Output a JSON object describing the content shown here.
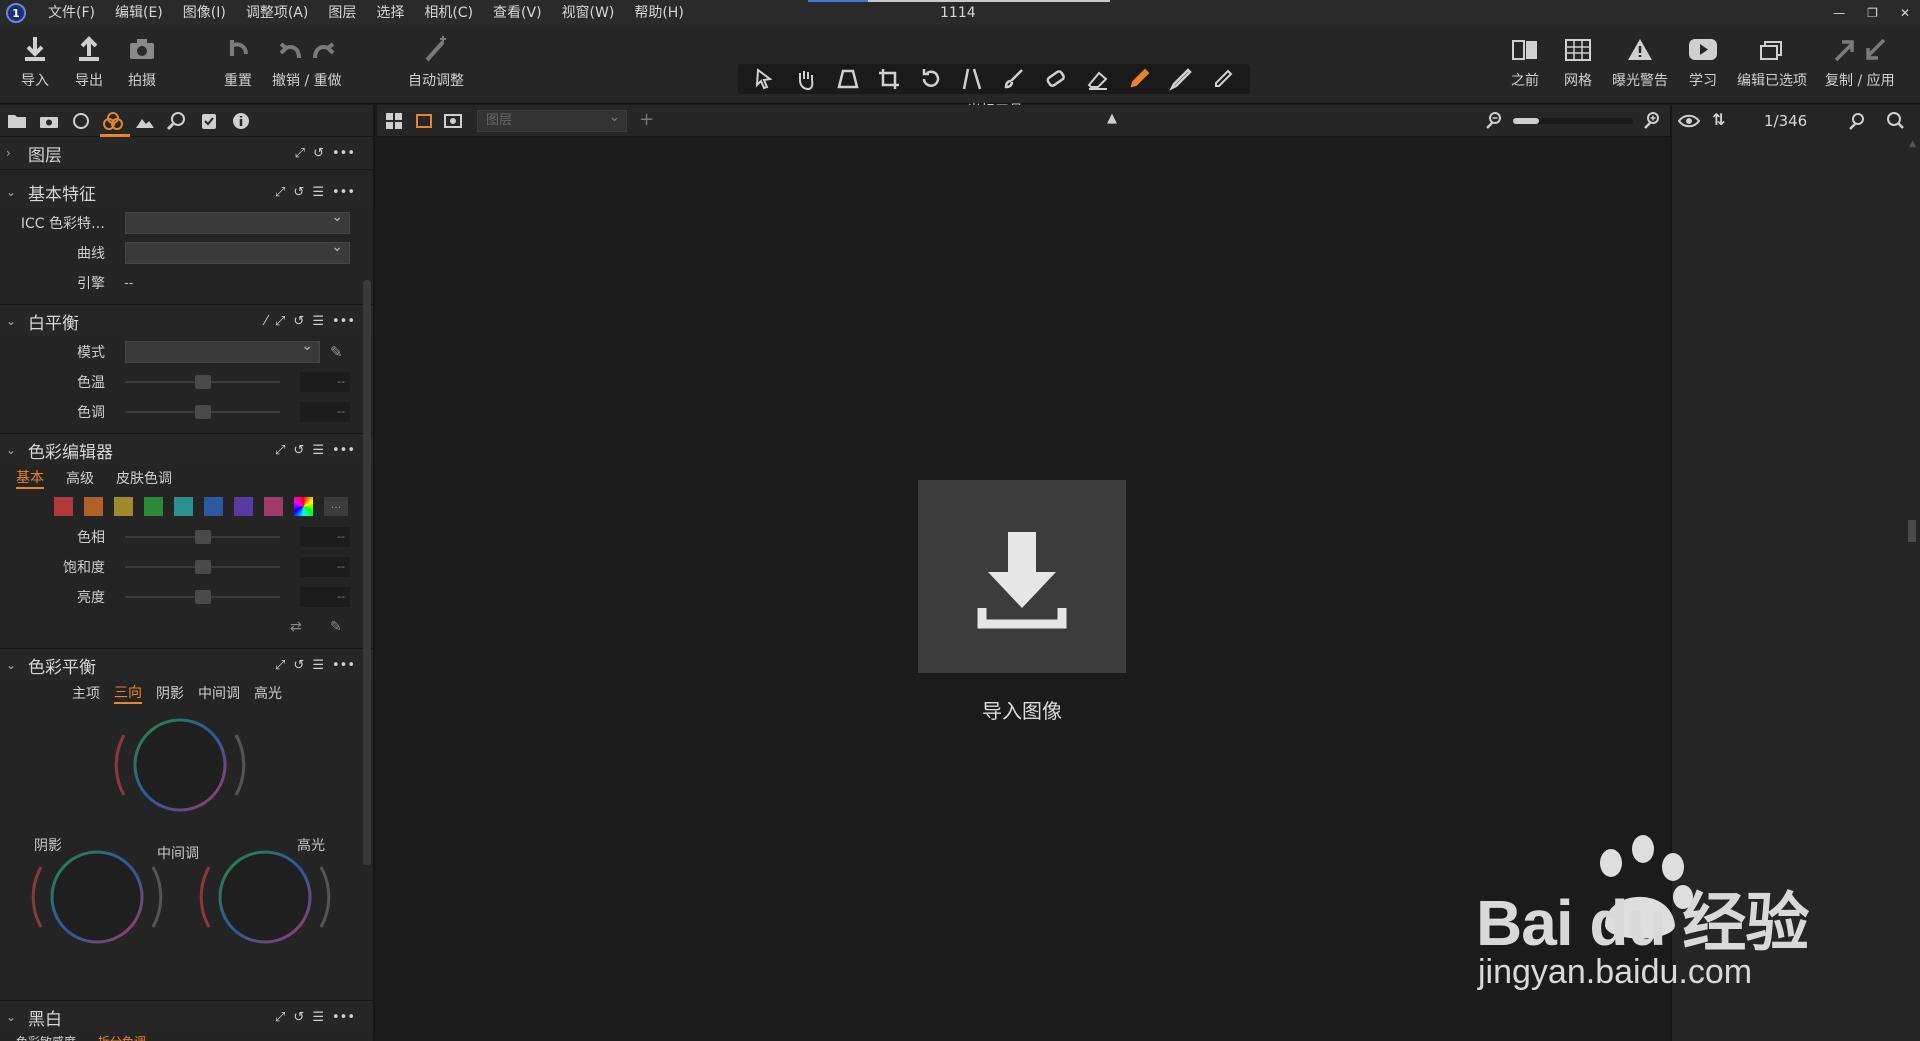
{
  "window": {
    "title": "1114",
    "logo_letter": "1"
  },
  "menu": [
    "文件(F)",
    "编辑(E)",
    "图像(I)",
    "调整项(A)",
    "图层",
    "选择",
    "相机(C)",
    "查看(V)",
    "视窗(W)",
    "帮助(H)"
  ],
  "toolbar": {
    "import": "导入",
    "export": "导出",
    "capture": "拍摄",
    "reset": "重置",
    "undo_redo": "撤销 / 重做",
    "auto_adjust": "自动调整",
    "cursor_tools": "光标工具",
    "before": "之前",
    "grid": "网格",
    "exposure_warning": "曝光警告",
    "learn": "学习",
    "edit_selected": "编辑已选项",
    "copy_apply": "复制 / 应用"
  },
  "left_panel": {
    "layers": {
      "title": "图层"
    },
    "basic": {
      "title": "基本特征",
      "icc_label": "ICC 色彩特…",
      "curve_label": "曲线",
      "engine_label": "引擎",
      "engine_value": "--"
    },
    "white_balance": {
      "title": "白平衡",
      "mode_label": "模式",
      "temp_label": "色温",
      "tint_label": "色调",
      "temp_value": "--",
      "tint_value": "--"
    },
    "color_editor": {
      "title": "色彩编辑器",
      "tabs": [
        "基本",
        "高级",
        "皮肤色调"
      ],
      "more": "...",
      "hue_label": "色相",
      "sat_label": "饱和度",
      "light_label": "亮度",
      "hue_value": "--",
      "sat_value": "--",
      "light_value": "--",
      "swatch_colors": [
        "#b03a3a",
        "#b0602a",
        "#a08a2a",
        "#2a8a3a",
        "#2a9090",
        "#2a5aa0",
        "#5a3aa0",
        "#8a3a90",
        "#a03a6a"
      ]
    },
    "color_balance": {
      "title": "色彩平衡",
      "tabs": [
        "主项",
        "三向",
        "阴影",
        "中间调",
        "高光"
      ],
      "shadow_label": "阴影",
      "mid_label": "中间调",
      "high_label": "高光"
    },
    "bw": {
      "title": "黑白",
      "sub": [
        "色彩敏感度",
        "拆分色调"
      ]
    }
  },
  "viewer": {
    "layer_dropdown": "图层",
    "import_label": "导入图像"
  },
  "browser": {
    "counter": "1/346"
  },
  "watermark": {
    "brand": "Bai  du 经验",
    "url": "jingyan.baidu.com"
  }
}
